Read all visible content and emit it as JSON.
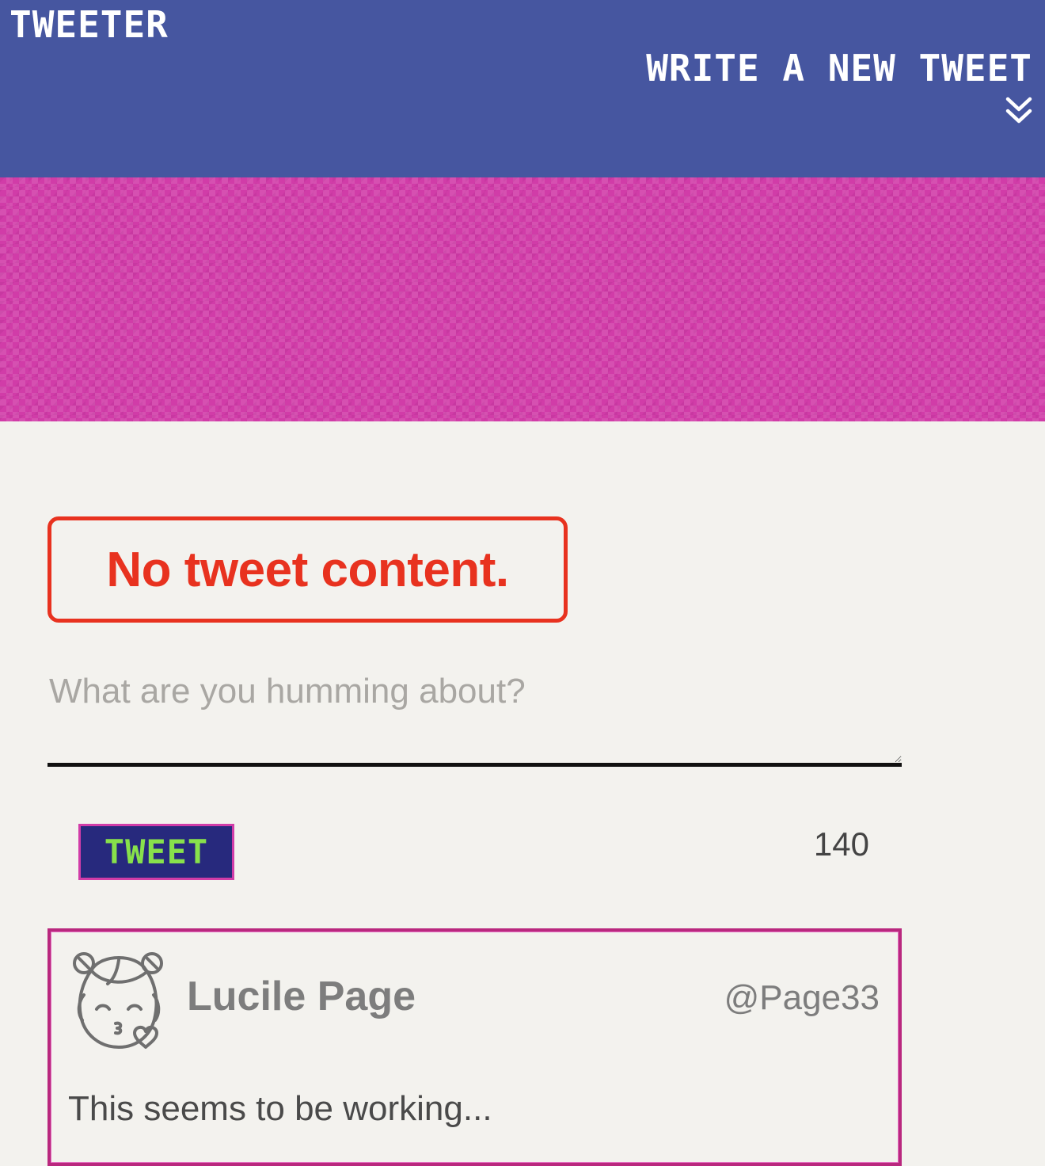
{
  "nav": {
    "brand": "Tweeter",
    "write_new_label": "Write a new tweet",
    "toggle_icon": "double-chevron-down-icon"
  },
  "colors": {
    "nav_bg": "#4656a0",
    "banner_bg": "#d13ca8",
    "page_bg": "#f3f2ee",
    "error": "#e8321f",
    "button_bg": "#27297d",
    "button_text": "#88e14b",
    "button_border": "#d13ca8"
  },
  "compose": {
    "error_message": "No tweet content.",
    "placeholder": "What are you humming about?",
    "value": "",
    "submit_label": "Tweet",
    "counter": "140"
  },
  "tweets": [
    {
      "avatar_icon": "kissing-girl-avatar-icon",
      "name": "Lucile Page",
      "handle": "@Page33",
      "content": "This seems to be working..."
    }
  ]
}
